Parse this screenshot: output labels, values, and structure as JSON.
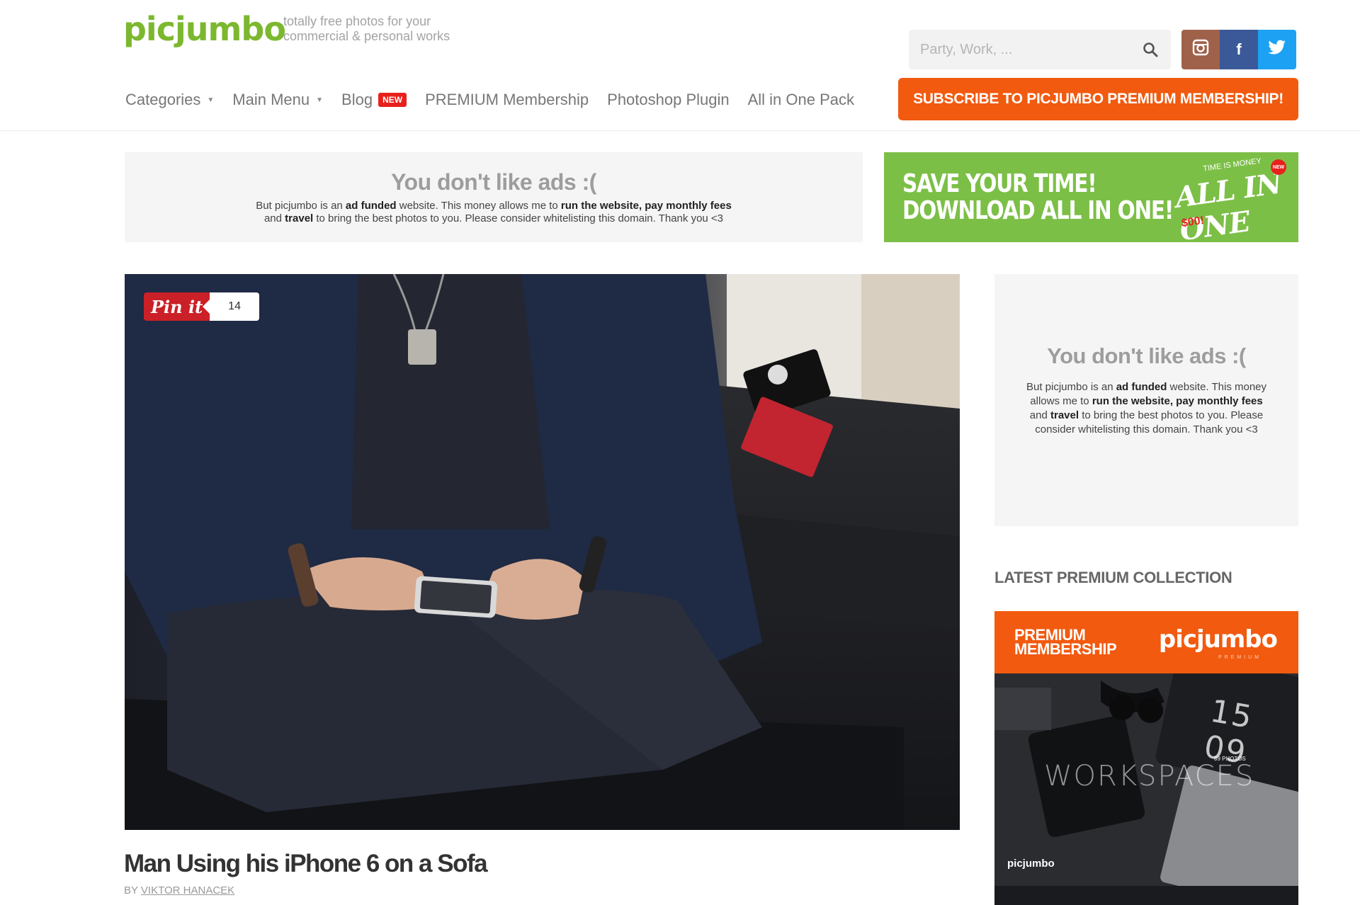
{
  "header": {
    "logo": "picjumbo",
    "tagline_line1": "totally free photos for your",
    "tagline_line2": "commercial & personal works",
    "search_placeholder": "Party, Work, ...",
    "social": {
      "instagram_icon": "instagram-icon",
      "facebook_icon": "f",
      "twitter_icon": "twitter-icon"
    },
    "nav": [
      {
        "label": "Categories",
        "has_caret": true
      },
      {
        "label": "Main Menu",
        "has_caret": true
      },
      {
        "label": "Blog",
        "badge": "NEW"
      },
      {
        "label": "PREMIUM Membership"
      },
      {
        "label": "Photoshop Plugin"
      },
      {
        "label": "All in One Pack"
      }
    ],
    "subscribe_label": "SUBSCRIBE TO PICJUMBO PREMIUM MEMBERSHIP!"
  },
  "ad_banner": {
    "title": "You don't like ads :(",
    "text_pre": "But picjumbo is an ",
    "bold1": "ad funded",
    "text_mid1": " website. This money allows me to ",
    "bold2": "run the website, pay monthly fees",
    "text_mid2": "and ",
    "bold3": "travel",
    "text_post": " to bring the best photos to you. Please consider whitelisting this domain. Thank you <3"
  },
  "aio_banner": {
    "line1": "SAVE YOUR TIME!",
    "line2": "DOWNLOAD ALL IN ONE!",
    "stamp_small": "TIME IS MONEY",
    "stamp_title": "ALL IN ONE",
    "stamp_price": "$00!",
    "stamp_new": "NEW"
  },
  "post": {
    "pin_label": "Pin it",
    "pin_count": "14",
    "title": "Man Using his iPhone 6 on a Sofa",
    "by": "BY ",
    "author": "VIKTOR HANACEK"
  },
  "sidebar": {
    "ad_title": "You don't like ads :(",
    "ad_text_pre": "But picjumbo is an ",
    "ad_bold1": "ad funded",
    "ad_text_mid1": " website. This money allows me to ",
    "ad_bold2": "run the website, pay monthly fees",
    "ad_text_mid2": " and ",
    "ad_bold3": "travel",
    "ad_text_post": " to bring the best photos to you. Please consider whitelisting this domain. Thank you <3",
    "section_heading": "LATEST PREMIUM COLLECTION",
    "premium": {
      "label_line1": "PREMIUM",
      "label_line2": "MEMBERSHIP",
      "logo": "picjumbo",
      "logo_sub": "PREMIUM",
      "collection": "WORKSPACES",
      "count": "89 PHOTOS",
      "brand": "picjumbo",
      "clock": "15 09"
    }
  },
  "colors": {
    "brand_green": "#7cb82f",
    "accent_orange": "#f15a0f",
    "pinterest_red": "#cb2027",
    "facebook_blue": "#3b5998",
    "twitter_blue": "#1da1f2"
  }
}
